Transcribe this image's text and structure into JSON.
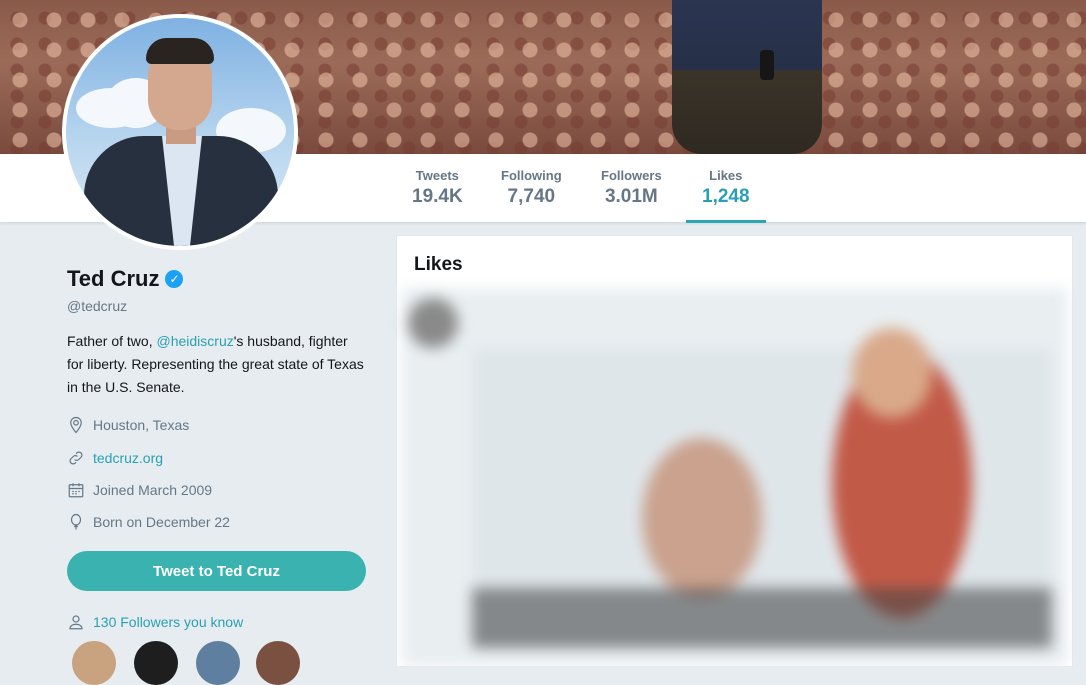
{
  "nav": {
    "stats": [
      {
        "label": "Tweets",
        "value": "19.4K"
      },
      {
        "label": "Following",
        "value": "7,740"
      },
      {
        "label": "Followers",
        "value": "3.01M"
      },
      {
        "label": "Likes",
        "value": "1,248"
      }
    ],
    "active_tab": "Likes"
  },
  "profile": {
    "name": "Ted Cruz",
    "handle": "@tedcruz",
    "bio_before": "Father of two, ",
    "bio_mention": "@heidiscruz",
    "bio_after": "'s husband, fighter for liberty. Representing the great state of Texas in the U.S. Senate.",
    "location": "Houston, Texas",
    "website": "tedcruz.org",
    "joined": "Joined March 2009",
    "born": "Born on December 22",
    "tweet_button": "Tweet to Ted Cruz",
    "followers_you_know": "130 Followers you know"
  },
  "likes": {
    "title": "Likes"
  },
  "colors": {
    "accent": "#2a9fb3",
    "button": "#39b2b0",
    "verified": "#1da1f2",
    "background": "#e6ecf0"
  },
  "icons": [
    "verified-icon",
    "location-icon",
    "link-icon",
    "calendar-icon",
    "balloon-icon",
    "person-icon"
  ]
}
